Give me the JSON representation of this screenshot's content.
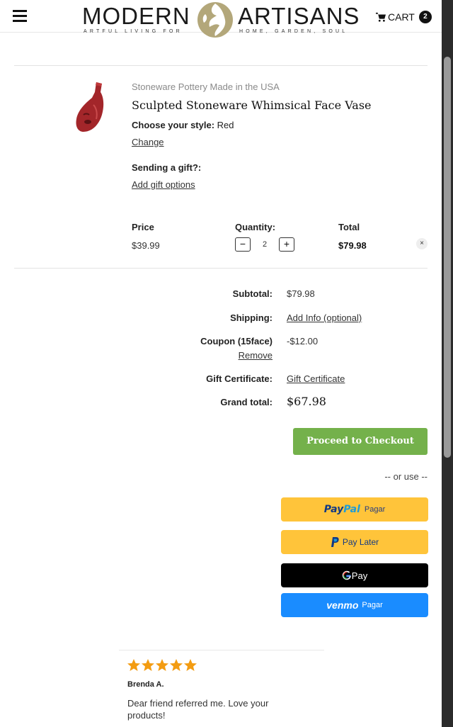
{
  "header": {
    "brand_left": "MODERN",
    "brand_right": "ARTISANS",
    "tagline_left": "ARTFUL LIVING FOR",
    "tagline_right": "HOME, GARDEN, SOUL",
    "cart_label": "CART",
    "cart_count": "2",
    "menu_icon": "hamburger-icon",
    "cart_icon": "shopping-cart-icon"
  },
  "cart_item": {
    "category": "Stoneware Pottery Made in the USA",
    "title": "Sculpted Stoneware Whimsical Face Vase",
    "style_label": "Choose your style:",
    "style_value": "Red",
    "change_link": "Change",
    "gift_label": "Sending a gift?:",
    "gift_link": "Add gift options",
    "price_label": "Price",
    "price": "$39.99",
    "quantity_label": "Quantity:",
    "quantity": "2",
    "qty_minus": "−",
    "qty_plus": "+",
    "total_label": "Total",
    "total": "$79.98",
    "remove_icon": "×",
    "image_color": "#a3262a"
  },
  "summary": {
    "subtotal_label": "Subtotal:",
    "subtotal": "$79.98",
    "shipping_label": "Shipping:",
    "shipping_link": "Add Info (optional)",
    "coupon_label": "Coupon (15face)",
    "coupon_value": "-$12.00",
    "coupon_remove": "Remove",
    "gift_cert_label": "Gift Certificate:",
    "gift_cert_link": "Gift Certificate",
    "grand_total_label": "Grand total:",
    "grand_total": "$67.98"
  },
  "checkout": {
    "proceed_label": "Proceed to Checkout",
    "or_use": "-- or use --",
    "paypal_pay": "Pay",
    "paypal_pal": "Pal",
    "paypal_action": "Pagar",
    "paylater_label": "Pay Later",
    "gpay_label": "Pay",
    "venmo_label": "venmo",
    "venmo_action": "Pagar",
    "colors": {
      "checkout_green": "#74b14b",
      "paypal_yellow": "#ffc43a",
      "gpay_black": "#000000",
      "venmo_blue": "#1a8cff"
    }
  },
  "review": {
    "rating": 5,
    "max_rating": 5,
    "reviewer": "Brenda A.",
    "text": "Dear friend referred me. Love your products!",
    "star_color": "#f39c12"
  }
}
